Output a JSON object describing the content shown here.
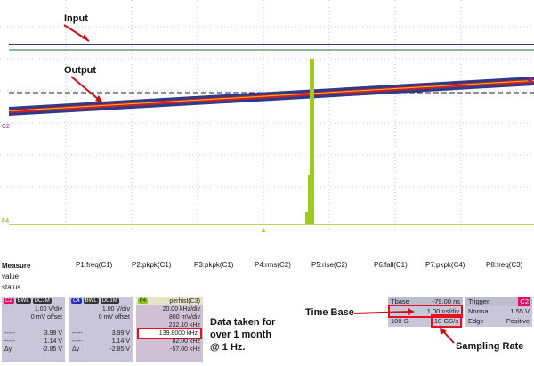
{
  "annotations": {
    "input": "Input",
    "output": "Output",
    "data_taken": [
      "Data taken for",
      "over 1 month",
      "@ 1 Hz."
    ],
    "time_base": "Time Base",
    "sampling_rate": "Sampling Rate"
  },
  "scope": {
    "channel_markers": {
      "c2": "C2",
      "f4": "F4"
    }
  },
  "measure": {
    "label": "Measure",
    "sub_labels": [
      "value",
      "status"
    ],
    "params": [
      "P1:freq(C1)",
      "P2:pkpk(C1)",
      "P3:pkpk(C1)",
      "P4:rms(C2)",
      "P5:rise(C2)",
      "P6:fall(C1)",
      "P7:pkpk(C4)",
      "P8:freq(C3)"
    ]
  },
  "channels": [
    {
      "tag": "C2",
      "badges": [
        "BWL",
        "DC1M"
      ],
      "vdiv": "1.00 V/div",
      "offset": "0 mV offset",
      "value1": "3.99 V",
      "value2": "1.14 V",
      "dy_label": "Δy",
      "value3": "-2.85 V",
      "color": "#e0106a"
    },
    {
      "tag": "C4",
      "badges": [
        "BWL",
        "DC1M"
      ],
      "vdiv": "1.00 V/div",
      "offset": "0 mV offset",
      "value1": "3.99 V",
      "value2": "1.14 V",
      "dy_label": "Δy",
      "value3": "-2.85 V",
      "color": "#2b2bc8"
    }
  ],
  "math": {
    "tag": "F4",
    "title": "perhist(C3)",
    "lines": [
      "20.00 kHz/div",
      "800 mV/div",
      "232.10 kHz",
      "139.8000 kHz",
      "82.00 kHz",
      "-57.00 kHz"
    ],
    "color": "#8fc21f"
  },
  "timebase": {
    "label": "Tbase",
    "offset": "-79.00 ns",
    "per_div": "1.00 ns/div",
    "span": "100 S",
    "rate": "10 GS/s"
  },
  "trigger": {
    "label": "Trigger",
    "channel": "C2",
    "mode": "Normal",
    "level": "1.55 V",
    "type": "Edge",
    "slope": "Positive"
  },
  "colors": {
    "highlight": "#e8101e",
    "grid": "#9a9a9a",
    "input_trace": "#2f3a8c",
    "output_trace_red": "#d02020",
    "hist": "#9dcc1f"
  }
}
